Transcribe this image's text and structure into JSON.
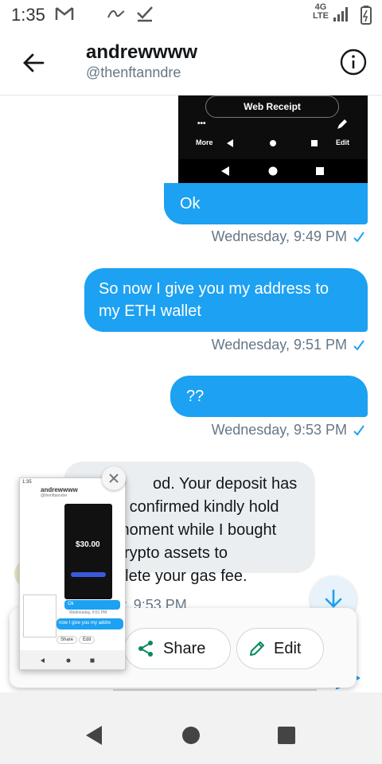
{
  "status_bar": {
    "time": "1:35",
    "network": [
      "4G",
      "LTE"
    ]
  },
  "header": {
    "name": "andrewwww",
    "handle": "@thenftanndre"
  },
  "attached_image": {
    "web_receipt_label": "Web Receipt",
    "dots": "•••",
    "more_label": "More",
    "edit_label": "Edit"
  },
  "messages": [
    {
      "text": "Ok",
      "timestamp": "Wednesday, 9:49 PM"
    },
    {
      "text": "So now I give you my address to my ETH wallet",
      "timestamp": "Wednesday, 9:51 PM"
    },
    {
      "text": "??",
      "timestamp": "Wednesday, 9:53 PM"
    }
  ],
  "incoming": {
    "text_lines": [
      "od. Your deposit has",
      "n confirmed kindly hold",
      "moment while I bought",
      "crypto assets to",
      "plete your gas fee."
    ],
    "timestamp": "edav. 9:53 PM"
  },
  "share_sheet": {
    "share_label": "Share",
    "edit_label": "Edit"
  },
  "thumbnail": {
    "time": "1:35",
    "name": "andrewwww",
    "handle": "@thenftanndre",
    "amount": "$30.00",
    "ok": "Ok",
    "timestamp": "Wednesday, 9:51 PM",
    "snippet": "now I give you my addre",
    "share": "Share",
    "edit": "Edit"
  },
  "colors": {
    "accent": "#1da1f2",
    "incoming_bubble": "#ebeef0",
    "meta_text": "#657786"
  }
}
